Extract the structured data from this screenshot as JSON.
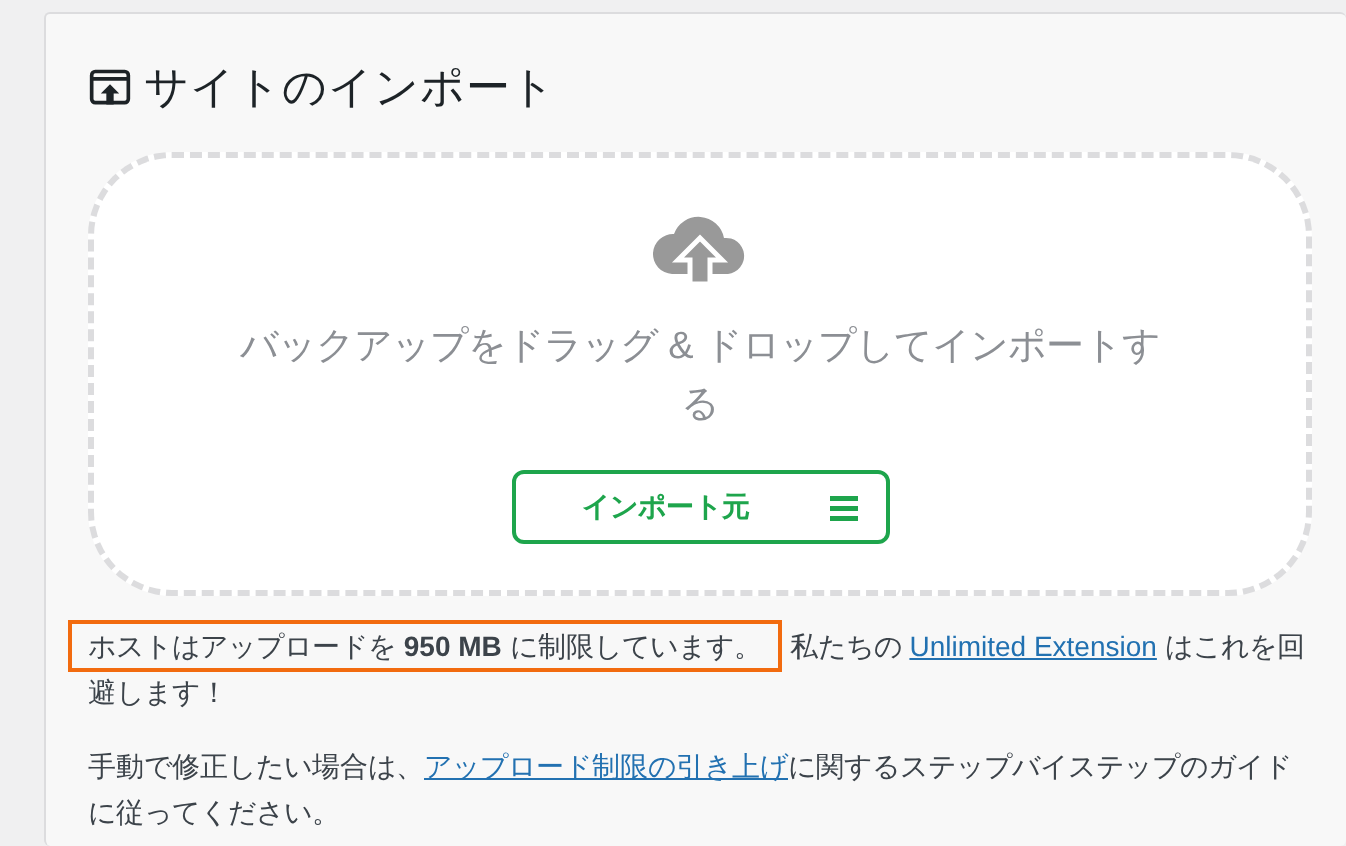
{
  "panel": {
    "title": "サイトのインポート"
  },
  "dropzone": {
    "text": "バックアップをドラッグ & ドロップしてインポートする",
    "button": {
      "label": "インポート元"
    }
  },
  "notices": [
    {
      "highlighted": "ホストはアップロードを **950 MB** に制限しています。",
      "before": "私たちの ",
      "link": "Unlimited Extension",
      "after": " はこれを回避します！"
    },
    {
      "before": "手動で修正したい場合は、",
      "link": "アップロード制限の引き上げ",
      "after": "に関するステップバイステップのガイドに従ってください。"
    }
  ]
}
